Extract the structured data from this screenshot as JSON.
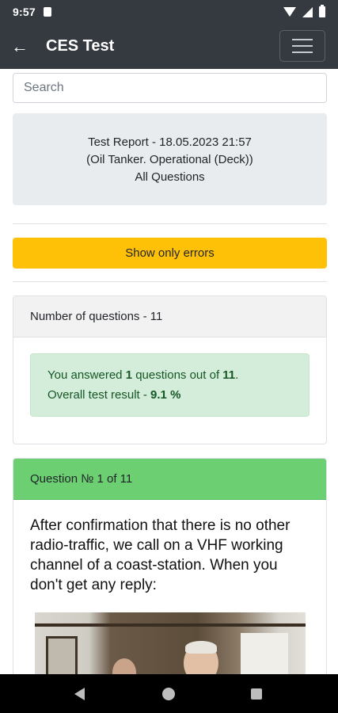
{
  "status_bar": {
    "time": "9:57"
  },
  "app_bar": {
    "back_glyph": "←",
    "title": "CES Test"
  },
  "search": {
    "placeholder": "Search",
    "value": ""
  },
  "report": {
    "line1": "Test Report - 18.05.2023 21:57",
    "line2": "(Oil Tanker. Operational (Deck))",
    "line3": "All Questions"
  },
  "errors_button": {
    "label": "Show only errors"
  },
  "summary_card": {
    "header": "Number of questions - 11",
    "answered_prefix": "You answered ",
    "answered_count": "1",
    "answered_middle": " questions out of ",
    "total_count": "11",
    "answered_suffix": ".",
    "result_prefix": "Overall test result - ",
    "result_value": "9.1 %"
  },
  "question_card": {
    "header": "Question № 1 of 11",
    "text": "After confirmation that there is no other radio-traffic, we call on a VHF working channel of a coast-station. When you don't get any reply:"
  },
  "colors": {
    "app_bar": "#343a40",
    "warning": "#ffc107",
    "success_header": "#6cd073",
    "alert_bg": "#d4edda",
    "alert_text": "#155724"
  },
  "icons": [
    "arrow-left-icon",
    "hamburger-menu-icon",
    "wifi-icon",
    "signal-icon",
    "battery-icon",
    "nav-back-icon",
    "nav-home-icon",
    "nav-recents-icon"
  ]
}
